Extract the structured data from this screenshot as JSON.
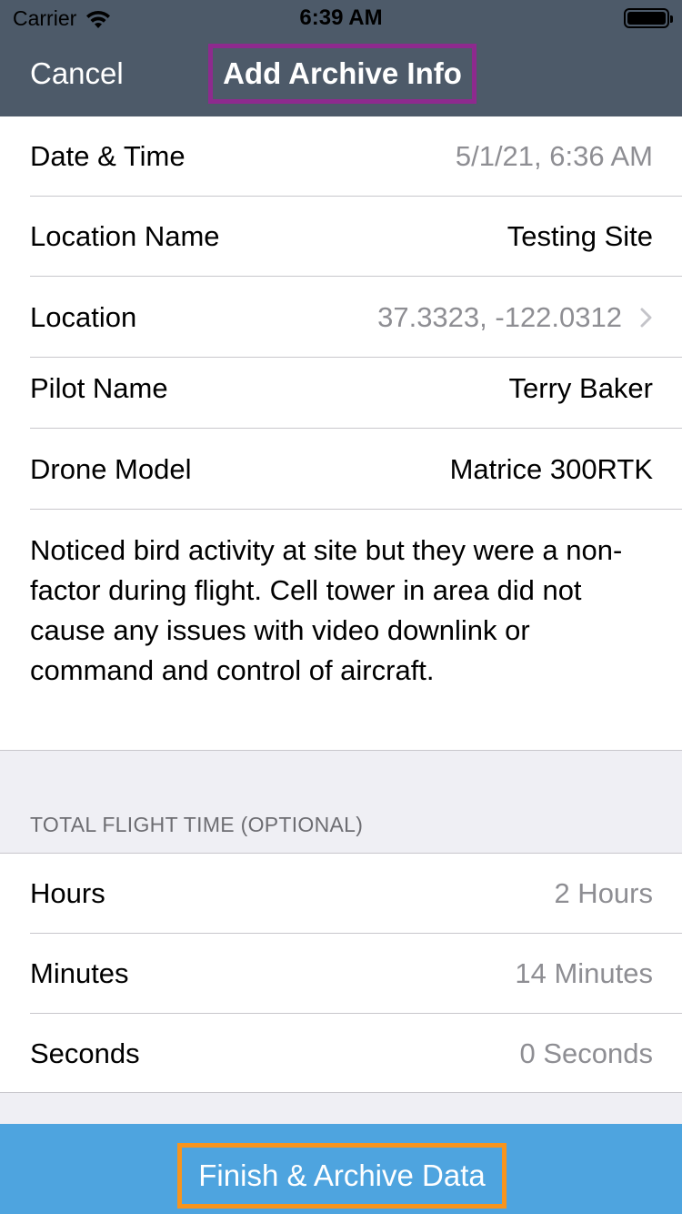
{
  "status_bar": {
    "carrier": "Carrier",
    "time": "6:39 AM",
    "wifi_icon": "wifi-icon",
    "battery_icon": "battery-icon",
    "battery_level": 1.0
  },
  "nav": {
    "cancel_label": "Cancel",
    "title": "Add Archive Info",
    "title_highlight_color": "#8e2a8e",
    "bar_color": "#4d5a69"
  },
  "details": {
    "date_time": {
      "label": "Date & Time",
      "value": "5/1/21, 6:36 AM"
    },
    "location_name": {
      "label": "Location Name",
      "value": "Testing Site"
    },
    "location": {
      "label": "Location",
      "value": "37.3323, -122.0312",
      "icon": "chevron-right-icon"
    },
    "pilot_name": {
      "label": "Pilot Name",
      "value": "Terry Baker"
    },
    "drone_model": {
      "label": "Drone Model",
      "value": "Matrice 300RTK"
    },
    "notes": "Noticed bird activity at site but they were a non-factor during flight. Cell tower in area did not cause any issues with video downlink or command and control of aircraft."
  },
  "flight_time": {
    "header": "TOTAL FLIGHT TIME (OPTIONAL)",
    "hours": {
      "label": "Hours",
      "value": "2 Hours"
    },
    "minutes": {
      "label": "Minutes",
      "value": "14 Minutes"
    },
    "seconds": {
      "label": "Seconds",
      "value": "0 Seconds"
    }
  },
  "footer": {
    "finish_label": "Finish & Archive Data",
    "bar_color": "#4ea4df",
    "button_highlight_color": "#f7941d"
  }
}
